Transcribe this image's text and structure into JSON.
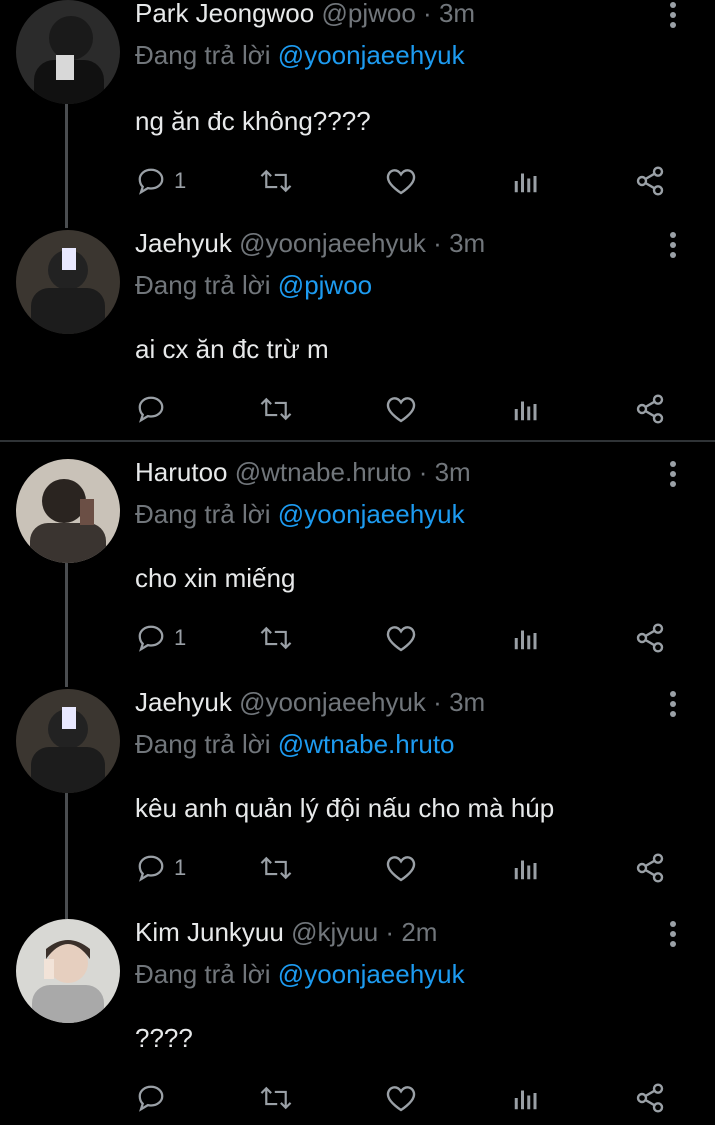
{
  "reply_prefix": "Đang trả lời",
  "tweets": [
    {
      "name": "Park Jeongwoo",
      "handle": "@pjwoo",
      "dot": "·",
      "time": "3m",
      "mention": "@yoonjaeehyuk",
      "text": "ng ăn đc không????",
      "reply_count": "1",
      "avatar_icon": "avatar-photo"
    },
    {
      "name": "Jaehyuk",
      "handle": "@yoonjaeehyuk",
      "dot": "·",
      "time": "3m",
      "mention": "@pjwoo",
      "text": "ai cx ăn đc trừ m",
      "reply_count": "",
      "avatar_icon": "avatar-photo"
    },
    {
      "name": "Harutoo",
      "handle": "@wtnabe.hruto",
      "dot": "·",
      "time": "3m",
      "mention": "@yoonjaeehyuk",
      "text": "cho xin miếng",
      "reply_count": "1",
      "avatar_icon": "avatar-photo"
    },
    {
      "name": "Jaehyuk",
      "handle": "@yoonjaeehyuk",
      "dot": "·",
      "time": "3m",
      "mention": "@wtnabe.hruto",
      "text": "kêu anh quản lý đội nấu cho mà húp",
      "reply_count": "1",
      "avatar_icon": "avatar-photo"
    },
    {
      "name": "Kim Junkyuu",
      "handle": "@kjyuu",
      "dot": "·",
      "time": "2m",
      "mention": "@yoonjaeehyuk",
      "text": "????",
      "reply_count": "",
      "avatar_icon": "avatar-photo"
    }
  ],
  "colors": {
    "background": "#000000",
    "text": "#e7e9ea",
    "muted": "#71767b",
    "link": "#1d9bf0",
    "icon": "#9aa0a6",
    "divider": "#2f3336"
  }
}
